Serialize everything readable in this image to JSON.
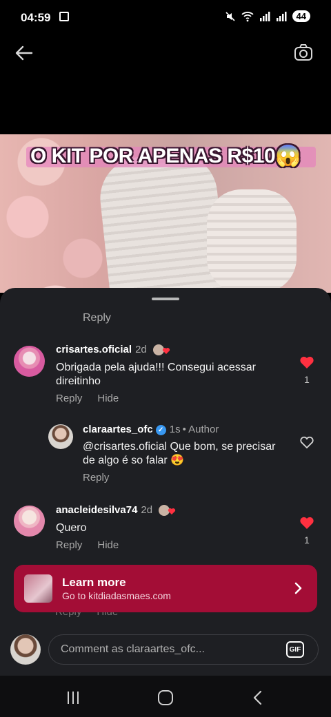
{
  "status_bar": {
    "time": "04:59",
    "battery": "44"
  },
  "video": {
    "caption": "O KIT POR APENAS R$10😱"
  },
  "comments_sheet": {
    "prev_reply_label": "Reply",
    "comments": [
      {
        "username": "crisartes.oficial",
        "time": "2d",
        "text": "Obrigada pela ajuda!!! Consegui acessar direitinho",
        "reply_label": "Reply",
        "hide_label": "Hide",
        "likes": "1",
        "liked": true
      },
      {
        "username": "claraartes_ofc",
        "time": "1s",
        "author_label": "• Author",
        "text": "@crisartes.oficial Que bom, se precisar de algo é so falar 😍",
        "reply_label": "Reply",
        "liked": false
      },
      {
        "username": "anacleidesilva74",
        "time": "2d",
        "text": "Quero",
        "reply_label": "Reply",
        "hide_label": "Hide",
        "likes": "1",
        "liked": true
      }
    ],
    "ad": {
      "title": "Learn more",
      "subtitle": "Go to kitdiadasmaes.com"
    },
    "under_ad": {
      "reply": "Reply",
      "hide": "Hide"
    },
    "composer": {
      "placeholder": "Comment as claraartes_ofc...",
      "gif_label": "GIF"
    }
  },
  "colors": {
    "accent_ad": "#a30d36",
    "heart_liked": "#ff3040",
    "sheet_bg": "#1e1f23",
    "verified": "#3897f0"
  },
  "icons": [
    "back-arrow-icon",
    "camera-icon",
    "heart-icon",
    "chevron-right-icon",
    "gif-icon",
    "verified-icon"
  ]
}
